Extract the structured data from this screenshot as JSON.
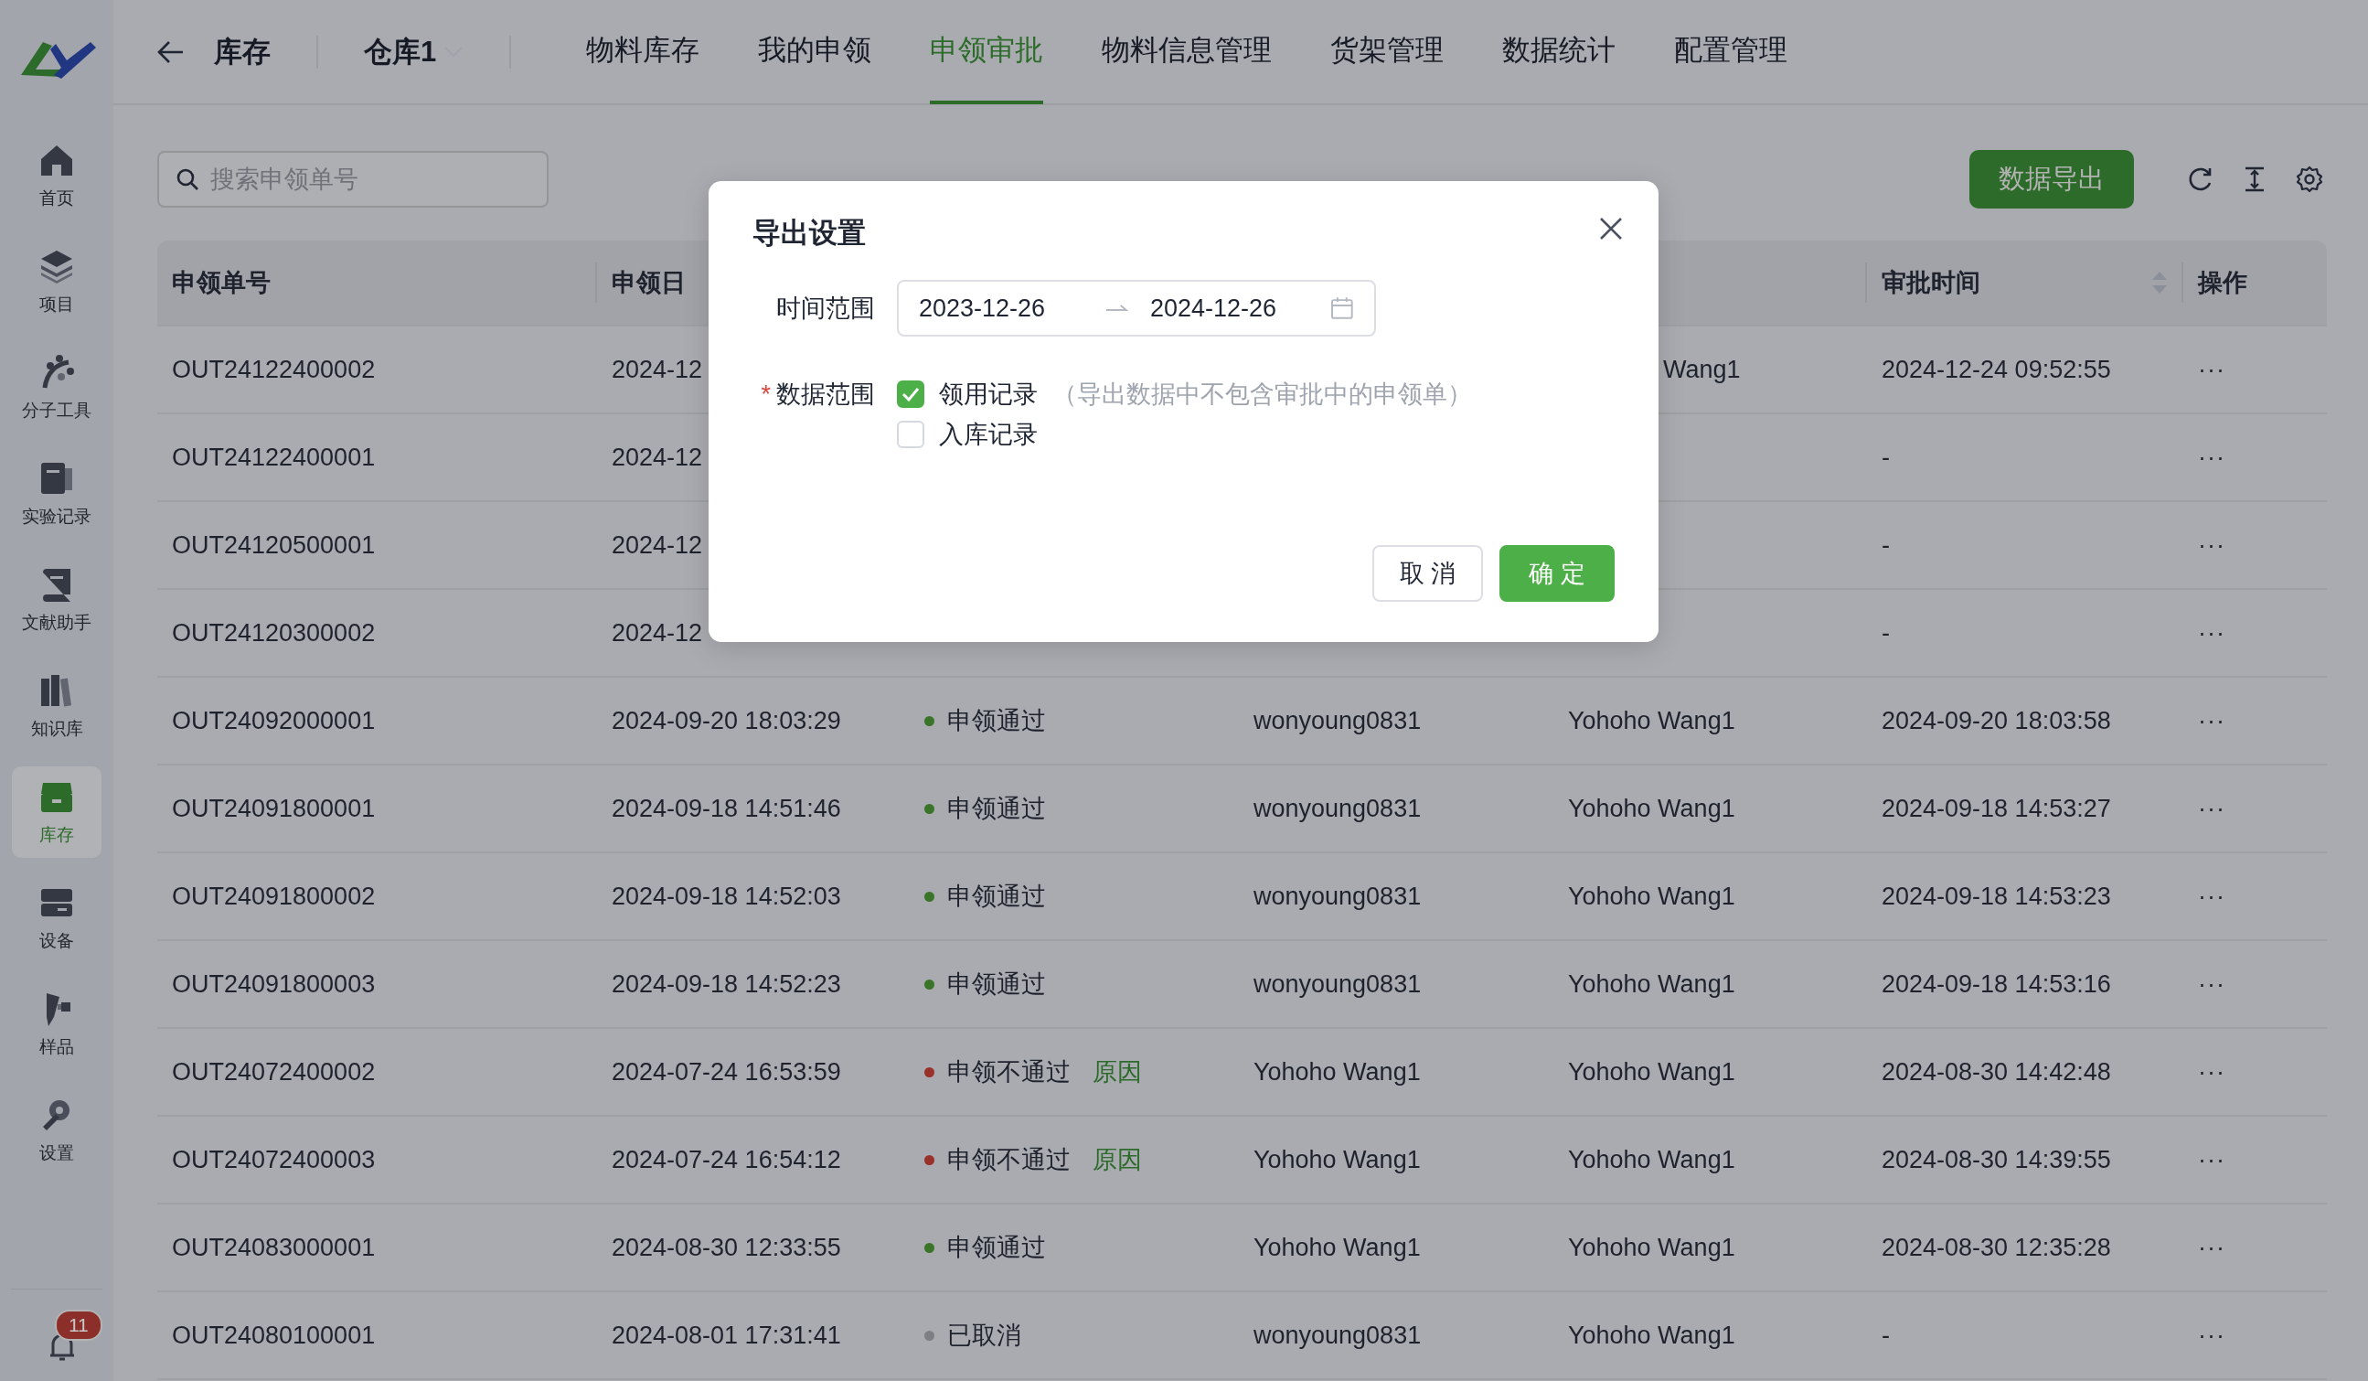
{
  "sidebar": {
    "items": [
      {
        "label": "首页",
        "selected": false
      },
      {
        "label": "项目",
        "selected": false
      },
      {
        "label": "分子工具",
        "selected": false
      },
      {
        "label": "实验记录",
        "selected": false
      },
      {
        "label": "文献助手",
        "selected": false
      },
      {
        "label": "知识库",
        "selected": false
      },
      {
        "label": "库存",
        "selected": true
      },
      {
        "label": "设备",
        "selected": false
      },
      {
        "label": "样品",
        "selected": false
      },
      {
        "label": "设置",
        "selected": false
      }
    ],
    "notifications": {
      "count": "11"
    }
  },
  "header": {
    "title": "库存",
    "warehouse": "仓库1",
    "tabs": [
      {
        "label": "物料库存",
        "selected": false
      },
      {
        "label": "我的申领",
        "selected": false
      },
      {
        "label": "申领审批",
        "selected": true
      },
      {
        "label": "物料信息管理",
        "selected": false
      },
      {
        "label": "货架管理",
        "selected": false
      },
      {
        "label": "数据统计",
        "selected": false
      },
      {
        "label": "配置管理",
        "selected": false
      }
    ]
  },
  "toolbar": {
    "search": {
      "placeholder": "搜索申领单号"
    },
    "export_button": "数据导出"
  },
  "table": {
    "columns": {
      "id": "申领单号",
      "date": "申领日",
      "approved_at": "审批时间",
      "actions": "操作"
    },
    "rows": [
      {
        "id": "OUT24122400002",
        "date": "2024-12",
        "approver": "Wang1",
        "approver_clipped": true,
        "approved_at": "2024-12-24 09:52:55",
        "actions": "···"
      },
      {
        "id": "OUT24122400001",
        "date": "2024-12",
        "approved_at": "-",
        "actions": "···"
      },
      {
        "id": "OUT24120500001",
        "date": "2024-12",
        "approved_at": "-",
        "actions": "···"
      },
      {
        "id": "OUT24120300002",
        "date": "2024-12",
        "approved_at": "-",
        "actions": "···"
      },
      {
        "id": "OUT24092000001",
        "date": "2024-09-20 18:03:29",
        "status": {
          "label": "申领通过",
          "color": "#3a7429"
        },
        "applicant": "wonyoung0831",
        "approver": "Yohoho Wang1",
        "approved_at": "2024-09-20 18:03:58",
        "actions": "···"
      },
      {
        "id": "OUT24091800001",
        "date": "2024-09-18 14:51:46",
        "status": {
          "label": "申领通过",
          "color": "#3a7429"
        },
        "applicant": "wonyoung0831",
        "approver": "Yohoho Wang1",
        "approved_at": "2024-09-18 14:53:27",
        "actions": "···"
      },
      {
        "id": "OUT24091800002",
        "date": "2024-09-18 14:52:03",
        "status": {
          "label": "申领通过",
          "color": "#3a7429"
        },
        "applicant": "wonyoung0831",
        "approver": "Yohoho Wang1",
        "approved_at": "2024-09-18 14:53:23",
        "actions": "···"
      },
      {
        "id": "OUT24091800003",
        "date": "2024-09-18 14:52:23",
        "status": {
          "label": "申领通过",
          "color": "#3a7429"
        },
        "applicant": "wonyoung0831",
        "approver": "Yohoho Wang1",
        "approved_at": "2024-09-18 14:53:16",
        "actions": "···"
      },
      {
        "id": "OUT24072400002",
        "date": "2024-07-24 16:53:59",
        "status": {
          "label": "申领不通过",
          "color": "#983129",
          "reason": "原因"
        },
        "applicant": "Yohoho Wang1",
        "approver": "Yohoho Wang1",
        "approved_at": "2024-08-30 14:42:48",
        "actions": "···"
      },
      {
        "id": "OUT24072400003",
        "date": "2024-07-24 16:54:12",
        "status": {
          "label": "申领不通过",
          "color": "#983129",
          "reason": "原因"
        },
        "applicant": "Yohoho Wang1",
        "approver": "Yohoho Wang1",
        "approved_at": "2024-08-30 14:39:55",
        "actions": "···"
      },
      {
        "id": "OUT24083000001",
        "date": "2024-08-30 12:33:55",
        "status": {
          "label": "申领通过",
          "color": "#3a7429"
        },
        "applicant": "Yohoho Wang1",
        "approver": "Yohoho Wang1",
        "approved_at": "2024-08-30 12:35:28",
        "actions": "···"
      },
      {
        "id": "OUT24080100001",
        "date": "2024-08-01 17:31:41",
        "status": {
          "label": "已取消",
          "color": "#7e7f84"
        },
        "applicant": "wonyoung0831",
        "approver": "Yohoho Wang1",
        "approved_at": "-",
        "actions": "···"
      }
    ]
  },
  "dialog": {
    "title": "导出设置",
    "time_range": {
      "label": "时间范围",
      "start": "2023-12-26",
      "end": "2024-12-26"
    },
    "data_range": {
      "label": "数据范围",
      "required_mark": "*",
      "options": [
        {
          "label": "领用记录",
          "checked": true,
          "note": "（导出数据中不包含审批中的申领单）"
        },
        {
          "label": "入库记录",
          "checked": false
        }
      ]
    },
    "buttons": {
      "cancel": "取 消",
      "confirm": "确 定"
    }
  }
}
